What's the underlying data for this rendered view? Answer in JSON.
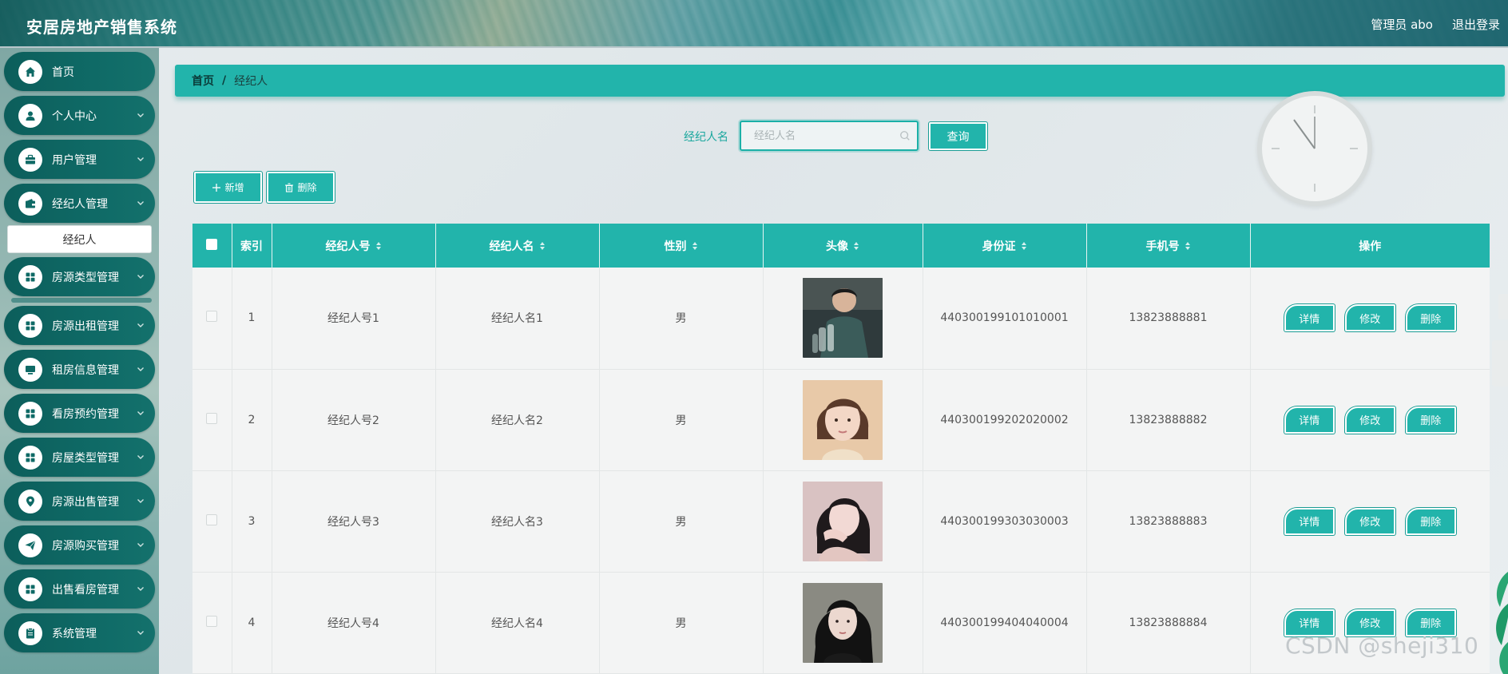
{
  "header": {
    "app_title": "安居房地产销售系统",
    "user_label": "管理员 abo",
    "logout_label": "退出登录"
  },
  "sidebar": {
    "items": [
      {
        "label": "首页",
        "icon": "home-icon",
        "has_chevron": false
      },
      {
        "label": "个人中心",
        "icon": "user-icon",
        "has_chevron": true
      },
      {
        "label": "用户管理",
        "icon": "briefcase-icon",
        "has_chevron": true
      },
      {
        "label": "经纪人管理",
        "icon": "wallet-icon",
        "has_chevron": true
      },
      {
        "label": "房源类型管理",
        "icon": "grid-icon",
        "has_chevron": true
      },
      {
        "label": "房源出租管理",
        "icon": "grid-icon",
        "has_chevron": true
      },
      {
        "label": "租房信息管理",
        "icon": "monitor-icon",
        "has_chevron": true
      },
      {
        "label": "看房预约管理",
        "icon": "grid-icon",
        "has_chevron": true
      },
      {
        "label": "房屋类型管理",
        "icon": "grid-icon",
        "has_chevron": true
      },
      {
        "label": "房源出售管理",
        "icon": "location-pin-icon",
        "has_chevron": true
      },
      {
        "label": "房源购买管理",
        "icon": "paper-plane-icon",
        "has_chevron": true
      },
      {
        "label": "出售看房管理",
        "icon": "grid-icon",
        "has_chevron": true
      },
      {
        "label": "系统管理",
        "icon": "clipboard-icon",
        "has_chevron": true
      }
    ],
    "submenu": {
      "label": "经纪人"
    }
  },
  "breadcrumb": {
    "home": "首页",
    "separator": "/",
    "current": "经纪人"
  },
  "search": {
    "label": "经纪人名",
    "placeholder": "经纪人名",
    "value": "",
    "button_label": "查询"
  },
  "toolbar": {
    "add_label": "新增",
    "delete_label": "删除"
  },
  "table": {
    "columns": [
      "",
      "索引",
      "经纪人号",
      "经纪人名",
      "性别",
      "头像",
      "身份证",
      "手机号",
      "操作"
    ],
    "sortable": [
      false,
      false,
      true,
      true,
      true,
      true,
      true,
      true,
      false
    ],
    "rows": [
      {
        "index": "1",
        "agent_no": "经纪人号1",
        "agent_name": "经纪人名1",
        "gender": "男",
        "avatar": "avatar-photo-man-bottles",
        "id_card": "440300199101010001",
        "phone": "13823888881"
      },
      {
        "index": "2",
        "agent_no": "经纪人号2",
        "agent_name": "经纪人名2",
        "gender": "男",
        "avatar": "avatar-photo-girl-bob",
        "id_card": "440300199202020002",
        "phone": "13823888882"
      },
      {
        "index": "3",
        "agent_no": "经纪人号3",
        "agent_name": "经纪人名3",
        "gender": "男",
        "avatar": "avatar-photo-girl-hand",
        "id_card": "440300199303030003",
        "phone": "13823888883"
      },
      {
        "index": "4",
        "agent_no": "经纪人号4",
        "agent_name": "经纪人名4",
        "gender": "男",
        "avatar": "avatar-photo-girl-dark",
        "id_card": "440300199404040004",
        "phone": "13823888884"
      }
    ],
    "row_actions": {
      "detail": "详情",
      "edit": "修改",
      "delete": "删除"
    }
  },
  "watermark": "CSDN @sheji310",
  "colors": {
    "accent": "#22b4ab",
    "menu_bg": "#0f6a66",
    "breadcrumb_text": "#0b3b39"
  }
}
